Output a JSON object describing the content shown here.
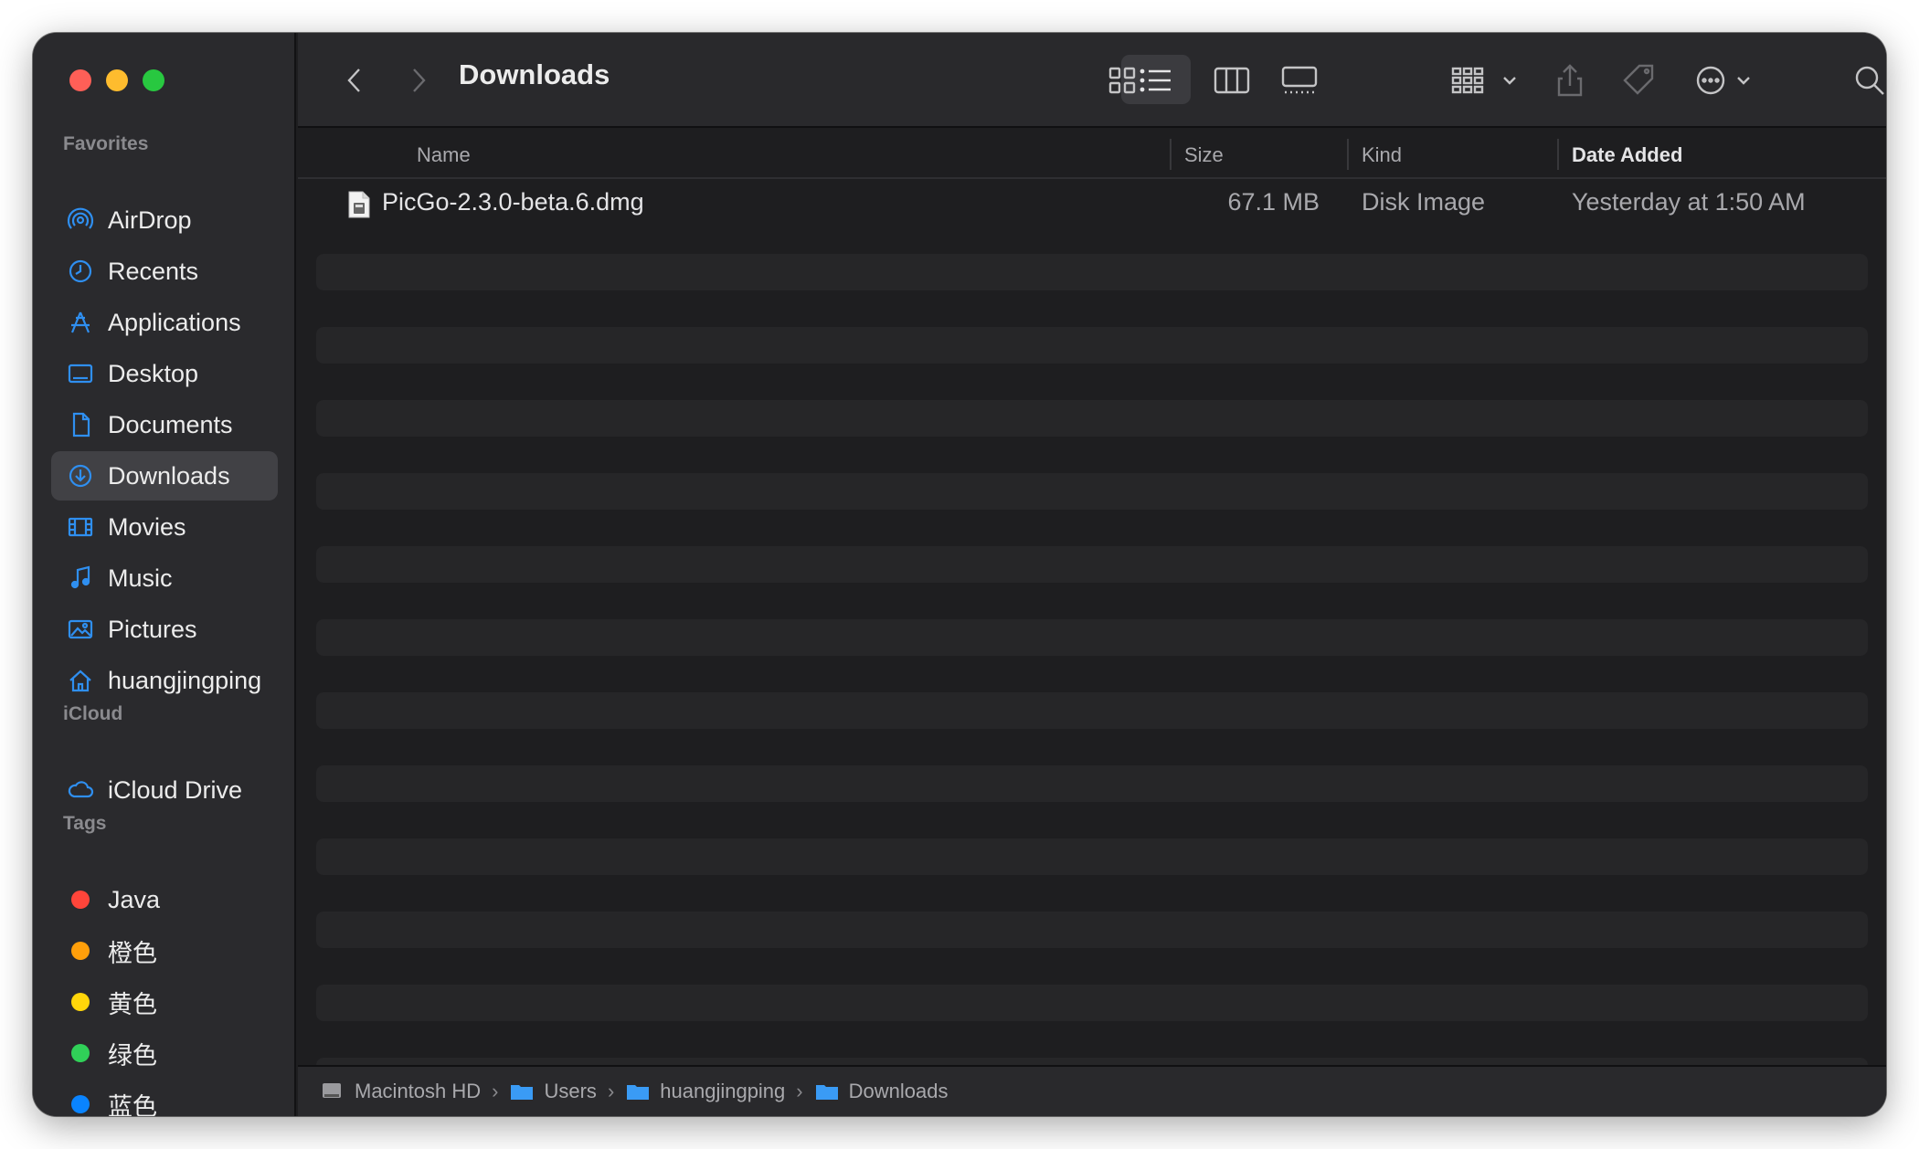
{
  "window": {
    "title": "Downloads"
  },
  "traffic_lights": {
    "close": "#fe5f57",
    "minimize": "#febc2e",
    "maximize": "#28c840"
  },
  "sidebar": {
    "favorites_label": "Favorites",
    "favorites": [
      {
        "label": "AirDrop",
        "icon": "airdrop-icon"
      },
      {
        "label": "Recents",
        "icon": "clock-icon"
      },
      {
        "label": "Applications",
        "icon": "applications-icon"
      },
      {
        "label": "Desktop",
        "icon": "desktop-icon"
      },
      {
        "label": "Documents",
        "icon": "document-icon"
      },
      {
        "label": "Downloads",
        "icon": "download-icon",
        "active": true
      },
      {
        "label": "Movies",
        "icon": "film-icon"
      },
      {
        "label": "Music",
        "icon": "music-note-icon"
      },
      {
        "label": "Pictures",
        "icon": "photo-icon"
      },
      {
        "label": "huangjingping",
        "icon": "home-icon"
      }
    ],
    "icloud_label": "iCloud",
    "icloud": [
      {
        "label": "iCloud Drive",
        "icon": "cloud-icon"
      }
    ],
    "tags_label": "Tags",
    "tags": [
      {
        "label": "Java",
        "color": "#ff453a"
      },
      {
        "label": "橙色",
        "color": "#ff9f0a"
      },
      {
        "label": "黄色",
        "color": "#ffd60a"
      },
      {
        "label": "绿色",
        "color": "#30d158"
      },
      {
        "label": "蓝色",
        "color": "#0a84ff"
      }
    ]
  },
  "columns": {
    "name": "Name",
    "size": "Size",
    "kind": "Kind",
    "date_added": "Date Added"
  },
  "files": [
    {
      "name": "PicGo-2.3.0-beta.6.dmg",
      "size": "67.1 MB",
      "kind": "Disk Image",
      "date_added": "Yesterday at 1:50 AM"
    }
  ],
  "path": [
    "Macintosh HD",
    "Users",
    "huangjingping",
    "Downloads"
  ],
  "accent_color": "#2f8ff0"
}
